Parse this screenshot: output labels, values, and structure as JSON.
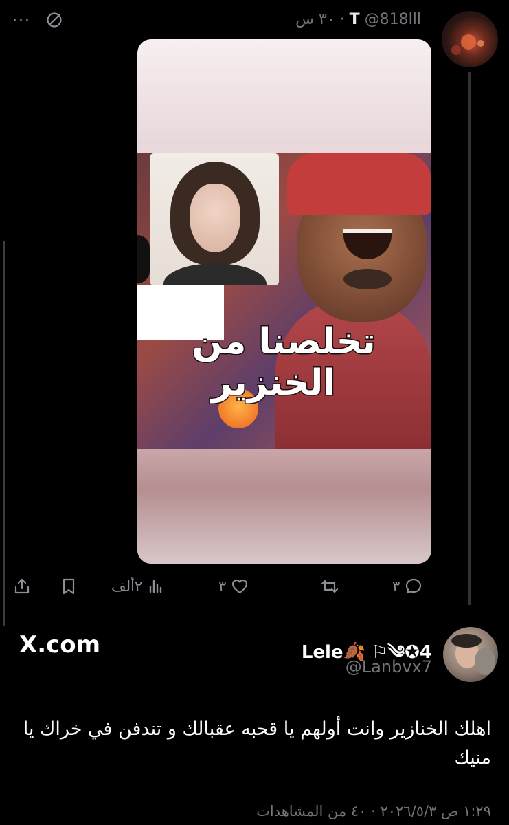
{
  "top_tweet": {
    "display_name": "T",
    "handle": "@818lll",
    "time": "٣٠ س",
    "more_label": "···",
    "media": {
      "caption_line1": "تخلصنا من",
      "caption_line2": "الخنزير"
    },
    "actions": {
      "replies": "٣",
      "retweets": "",
      "likes": "٣",
      "views": "٢ألف"
    }
  },
  "reply_tweet": {
    "watermark": "X.com",
    "display_name": "Lele🍂 ⚐༄✪4",
    "handle": "@Lanbvx7",
    "text": "اهلك الخنازير وانت أولهم يا قحبه عقبالك و تندفن في خراك يا منيك",
    "meta": "١:٢٩ ص ٢٠٢٦/٥/٣ · ٤٠ من المشاهدات"
  },
  "colors": {
    "background": "#000000",
    "text": "#e7e9ea",
    "secondary": "#71767b",
    "divider": "#2f3336"
  },
  "icons": [
    "more-icon",
    "block-icon",
    "reply-icon",
    "retweet-icon",
    "like-icon",
    "views-icon",
    "bookmark-icon",
    "share-icon"
  ]
}
